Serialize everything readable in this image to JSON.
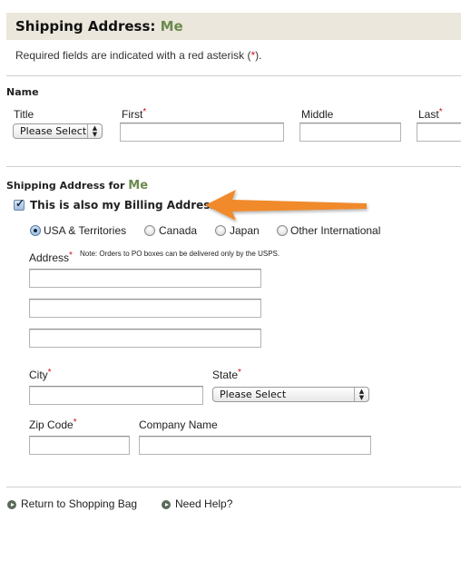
{
  "header": {
    "title": "Shipping Address:",
    "name": "Me",
    "required_note_prefix": "Required fields are indicated with a red asterisk (",
    "required_note_asterisk": "*",
    "required_note_suffix": ")."
  },
  "name_section": {
    "label": "Name",
    "title_label": "Title",
    "title_select_value": "Please Select",
    "first_label": "First",
    "first_value": "",
    "middle_label": "Middle",
    "middle_value": "",
    "last_label": "Last",
    "last_value": "",
    "required_marker": "*"
  },
  "shipping_section": {
    "label": "Shipping Address for",
    "name": "Me",
    "billing_checkbox_label": "This is also my Billing Address",
    "billing_checked": true,
    "country_options": [
      {
        "label": "USA & Territories",
        "selected": true
      },
      {
        "label": "Canada",
        "selected": false
      },
      {
        "label": "Japan",
        "selected": false
      },
      {
        "label": "Other International",
        "selected": false
      }
    ],
    "address_label": "Address",
    "address_note": "Note: Orders to PO boxes can be delivered only by the USPS.",
    "address_lines": [
      "",
      "",
      ""
    ],
    "city_label": "City",
    "city_value": "",
    "state_label": "State",
    "state_select_value": "Please Select",
    "zip_label": "Zip Code",
    "zip_value": "",
    "company_label": "Company Name",
    "company_value": ""
  },
  "footer": {
    "return_link": "Return to Shopping Bag",
    "help_link": "Need Help?"
  },
  "annotation": {
    "arrow_color": "#f08a2c"
  },
  "colors": {
    "accent_green": "#6b8a4e",
    "header_bg": "#ebe7dc",
    "required_red": "#cc1122"
  }
}
